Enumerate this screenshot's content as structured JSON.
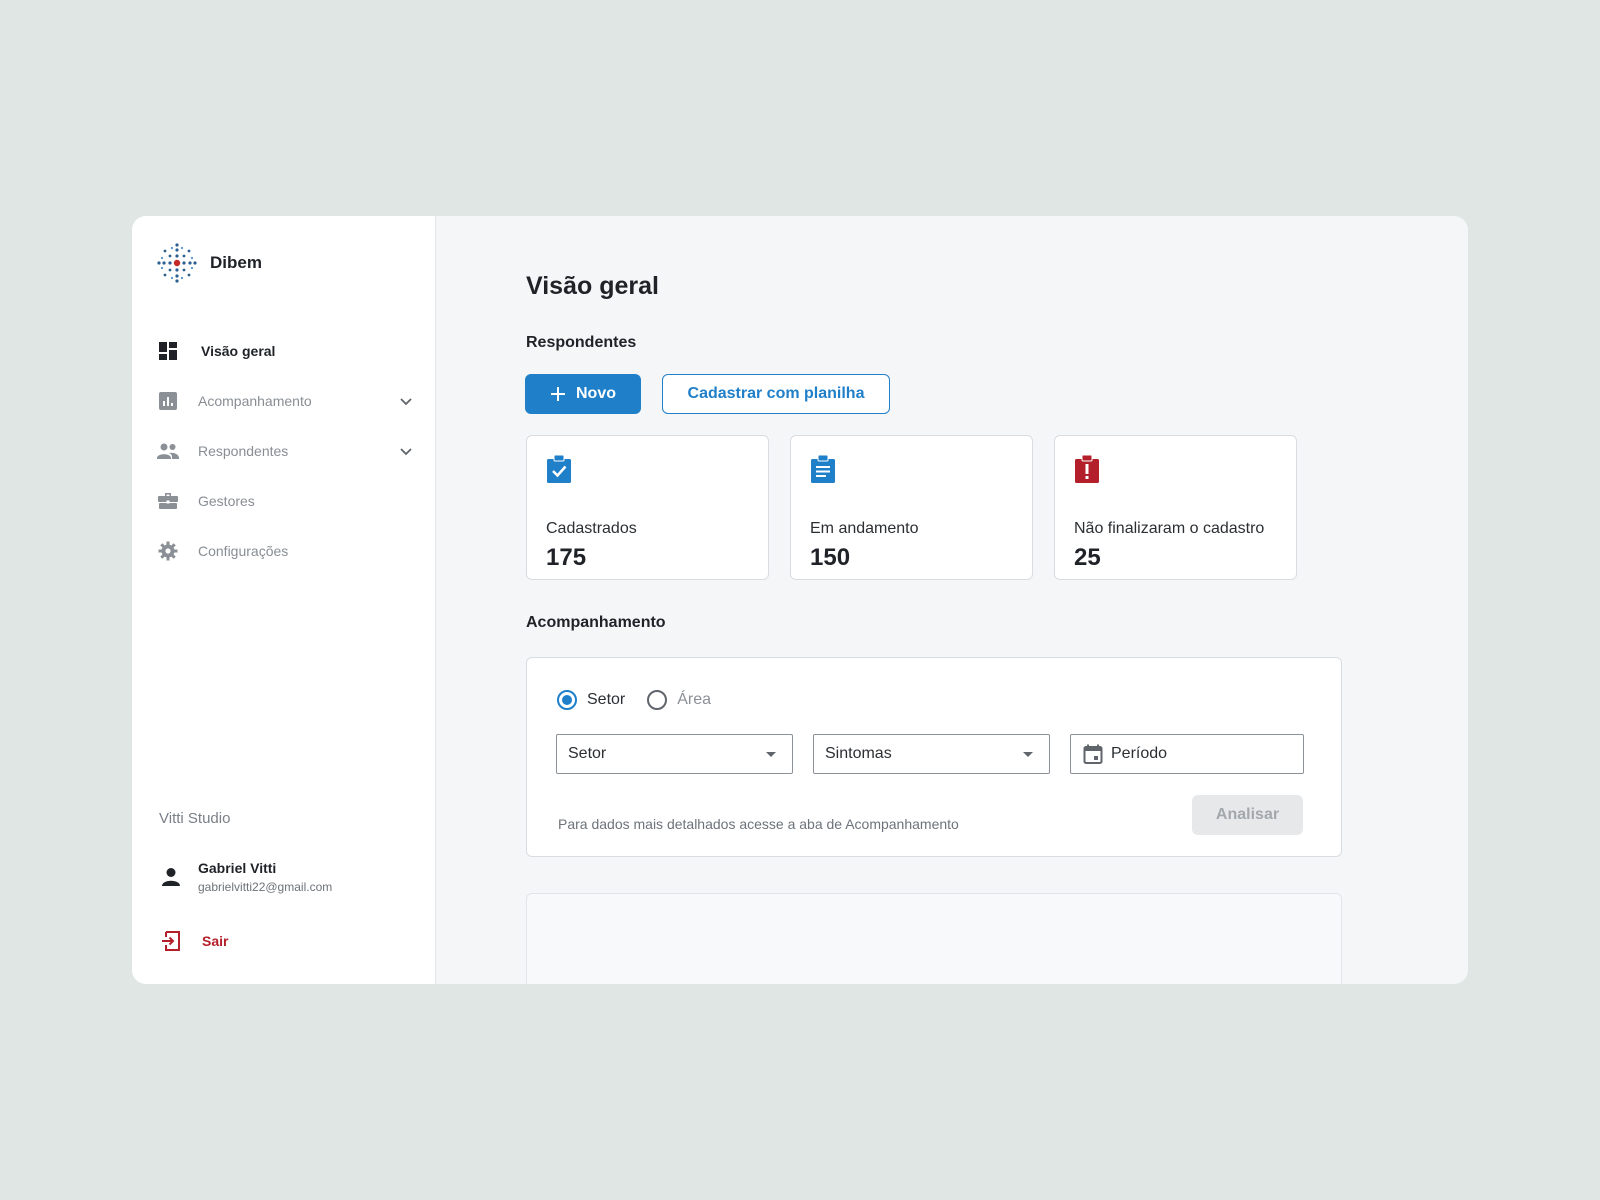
{
  "brand": {
    "name": "Dibem",
    "logo_icon": "spark-logo-icon"
  },
  "sidebar": {
    "items": [
      {
        "label": "Visão geral",
        "icon": "dashboard-icon",
        "active": true
      },
      {
        "label": "Acompanhamento",
        "icon": "bar-chart-icon",
        "expandable": true
      },
      {
        "label": "Respondentes",
        "icon": "people-icon",
        "expandable": true
      },
      {
        "label": "Gestores",
        "icon": "briefcase-icon"
      },
      {
        "label": "Configurações",
        "icon": "gear-icon"
      }
    ],
    "org": "Vitti Studio",
    "user": {
      "name": "Gabriel Vitti",
      "email": "gabrielvitti22@gmail.com"
    },
    "logout_label": "Sair"
  },
  "main": {
    "title": "Visão geral",
    "respondentes_title": "Respondentes",
    "new_button": "Novo",
    "upload_button": "Cadastrar com planilha",
    "stats": [
      {
        "label": "Cadastrados",
        "value": "175",
        "icon": "clipboard-check-icon",
        "color": "#1f7fc9"
      },
      {
        "label": "Em andamento",
        "value": "150",
        "icon": "clipboard-list-icon",
        "color": "#1f7fc9"
      },
      {
        "label": "Não finalizaram o cadastro",
        "value": "25",
        "icon": "clipboard-alert-icon",
        "color": "#b3202b"
      }
    ],
    "acompanhamento_title": "Acompanhamento",
    "filter": {
      "radio_setor": "Setor",
      "radio_area": "Área",
      "selected_radio": "Setor",
      "select_setor": "Setor",
      "select_sintomas": "Sintomas",
      "date_period": "Período",
      "hint": "Para dados mais detalhados acesse a aba de Acompanhamento",
      "analyze_button": "Analisar"
    }
  },
  "colors": {
    "primary": "#1f7fc9",
    "danger": "#b3202b"
  }
}
